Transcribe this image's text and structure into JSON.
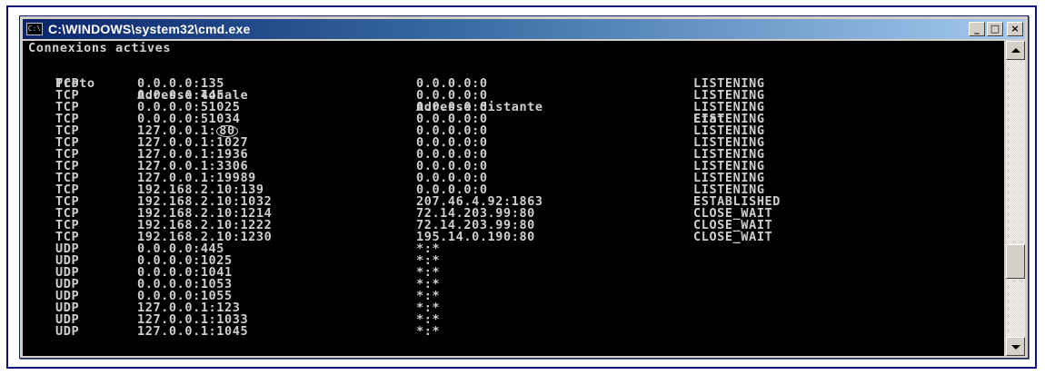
{
  "window": {
    "title": "C:\\WINDOWS\\system32\\cmd.exe",
    "icon": "cmd-icon",
    "buttons": {
      "minimize": "_",
      "maximize": "□",
      "close": "×"
    }
  },
  "console": {
    "heading": "Connexions actives",
    "columns": {
      "proto": "Proto",
      "local": "Adresse locale",
      "remote": "Adresse distante",
      "state": "Etat"
    },
    "rows": [
      {
        "proto": "TCP",
        "local": "0.0.0.0:135",
        "remote": "0.0.0.0:0",
        "state": "LISTENING"
      },
      {
        "proto": "TCP",
        "local": "0.0.0.0:445",
        "remote": "0.0.0.0:0",
        "state": "LISTENING"
      },
      {
        "proto": "TCP",
        "local": "0.0.0.0:51025",
        "remote": "0.0.0.0:0",
        "state": "LISTENING"
      },
      {
        "proto": "TCP",
        "local": "0.0.0.0:51034",
        "remote": "0.0.0.0:0",
        "state": "LISTENING"
      },
      {
        "proto": "TCP",
        "local_ip": "127.0.0.1:",
        "local_port_highlight": "80",
        "remote": "0.0.0.0:0",
        "state": "LISTENING"
      },
      {
        "proto": "TCP",
        "local": "127.0.0.1:1027",
        "remote": "0.0.0.0:0",
        "state": "LISTENING"
      },
      {
        "proto": "TCP",
        "local": "127.0.0.1:1936",
        "remote": "0.0.0.0:0",
        "state": "LISTENING"
      },
      {
        "proto": "TCP",
        "local": "127.0.0.1:3306",
        "remote": "0.0.0.0:0",
        "state": "LISTENING"
      },
      {
        "proto": "TCP",
        "local": "127.0.0.1:19989",
        "remote": "0.0.0.0:0",
        "state": "LISTENING"
      },
      {
        "proto": "TCP",
        "local": "192.168.2.10:139",
        "remote": "0.0.0.0:0",
        "state": "LISTENING"
      },
      {
        "proto": "TCP",
        "local": "192.168.2.10:1032",
        "remote": "207.46.4.92:1863",
        "state": "ESTABLISHED"
      },
      {
        "proto": "TCP",
        "local": "192.168.2.10:1214",
        "remote": "72.14.203.99:80",
        "state": "CLOSE_WAIT"
      },
      {
        "proto": "TCP",
        "local": "192.168.2.10:1222",
        "remote": "72.14.203.99:80",
        "state": "CLOSE_WAIT"
      },
      {
        "proto": "TCP",
        "local": "192.168.2.10:1230",
        "remote": "195.14.0.190:80",
        "state": "CLOSE_WAIT"
      },
      {
        "proto": "UDP",
        "local": "0.0.0.0:445",
        "remote": "*:*",
        "state": ""
      },
      {
        "proto": "UDP",
        "local": "0.0.0.0:1025",
        "remote": "*:*",
        "state": ""
      },
      {
        "proto": "UDP",
        "local": "0.0.0.0:1041",
        "remote": "*:*",
        "state": ""
      },
      {
        "proto": "UDP",
        "local": "0.0.0.0:1053",
        "remote": "*:*",
        "state": ""
      },
      {
        "proto": "UDP",
        "local": "0.0.0.0:1055",
        "remote": "*:*",
        "state": ""
      },
      {
        "proto": "UDP",
        "local": "127.0.0.1:123",
        "remote": "*:*",
        "state": ""
      },
      {
        "proto": "UDP",
        "local": "127.0.0.1:1033",
        "remote": "*:*",
        "state": ""
      },
      {
        "proto": "UDP",
        "local": "127.0.0.1:1045",
        "remote": "*:*",
        "state": ""
      }
    ]
  },
  "colors": {
    "title_start": "#0a246a",
    "title_end": "#a6caf0",
    "console_bg": "#000000",
    "console_text": "#cfcfcf"
  }
}
